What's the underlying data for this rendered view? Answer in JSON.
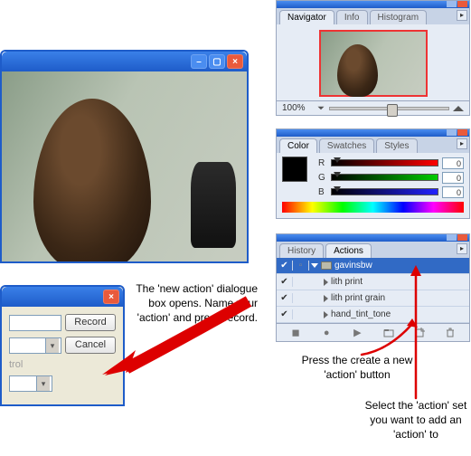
{
  "navigator": {
    "tabs": [
      "Navigator",
      "Info",
      "Histogram"
    ],
    "zoom": "100%"
  },
  "color": {
    "tabs": [
      "Color",
      "Swatches",
      "Styles"
    ],
    "channels": [
      {
        "label": "R",
        "value": "0"
      },
      {
        "label": "G",
        "value": "0"
      },
      {
        "label": "B",
        "value": "0"
      }
    ]
  },
  "actions": {
    "tabs": [
      "History",
      "Actions"
    ],
    "set_name": "gavinsbw",
    "items": [
      {
        "name": "lith print"
      },
      {
        "name": "lith print grain"
      },
      {
        "name": "hand_tint_tone"
      }
    ]
  },
  "dialog": {
    "record_label": "Record",
    "cancel_label": "Cancel",
    "partial_label": "trol"
  },
  "notes": {
    "dialog": "The 'new action' dialogue box opens. Name your 'action' and press record.",
    "create": "Press the create a new 'action' button",
    "select": "Select the 'action' set you want to add an 'action' to"
  }
}
